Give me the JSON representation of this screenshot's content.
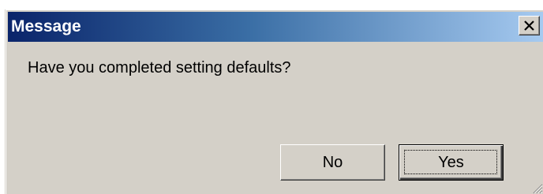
{
  "window": {
    "title": "Message",
    "close_icon": "close-icon"
  },
  "body": {
    "message": "Have you completed setting defaults?"
  },
  "buttons": {
    "no_label": "No",
    "yes_label": "Yes",
    "default": "Yes"
  },
  "colors": {
    "face": "#d4d0c8",
    "title_start": "#0a246a",
    "title_end": "#a6caf0",
    "title_text": "#ffffff"
  }
}
